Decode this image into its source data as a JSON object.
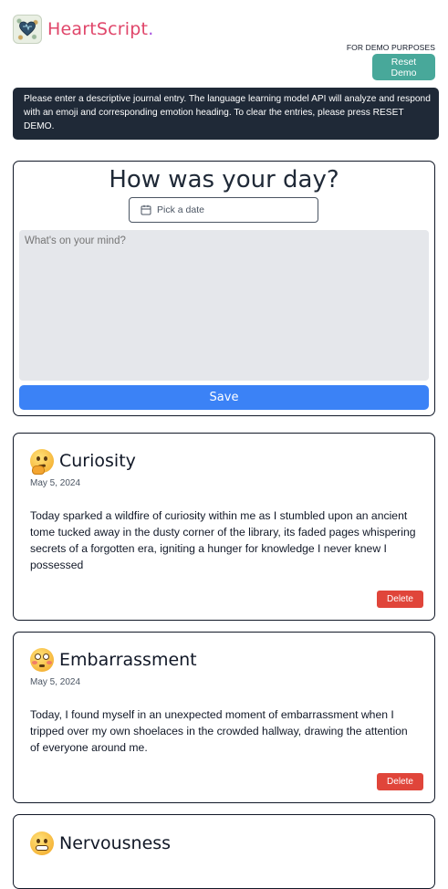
{
  "header": {
    "brand_part1": "HeartScript",
    "brand_part2": ".",
    "demo_note": "FOR DEMO PURPOSES",
    "reset_label": "Reset Demo"
  },
  "banner": {
    "text": "Please enter a descriptive journal entry. The language learning model API will analyze and respond with an emoji and corresponding emotion heading. To clear the entries, please press RESET DEMO."
  },
  "form": {
    "title": "How was your day?",
    "date_placeholder": "Pick a date",
    "textarea_placeholder": "What's on your mind?",
    "save_label": "Save"
  },
  "entries": [
    {
      "emoji": "thinking-face",
      "title": "Curiosity",
      "date": "May 5, 2024",
      "text": "Today sparked a wildfire of curiosity within me as I stumbled upon an ancient tome tucked away in the dusty corner of the library, its faded pages whispering secrets of a forgotten era, igniting a hunger for knowledge I never knew I possessed",
      "delete_label": "Delete"
    },
    {
      "emoji": "flushed-face",
      "title": "Embarrassment",
      "date": "May 5, 2024",
      "text": "Today, I found myself in an unexpected moment of embarrassment when I tripped over my own shoelaces in the crowded hallway, drawing the attention of everyone around me.",
      "delete_label": "Delete"
    },
    {
      "emoji": "grimacing-face",
      "title": "Nervousness"
    }
  ],
  "colors": {
    "brand_pink": "#e0466a",
    "brand_purple": "#a64fe0",
    "reset_teal": "#48a89a",
    "banner_bg": "#1f2937",
    "save_blue": "#3b82f6",
    "delete_red": "#e0453a"
  }
}
